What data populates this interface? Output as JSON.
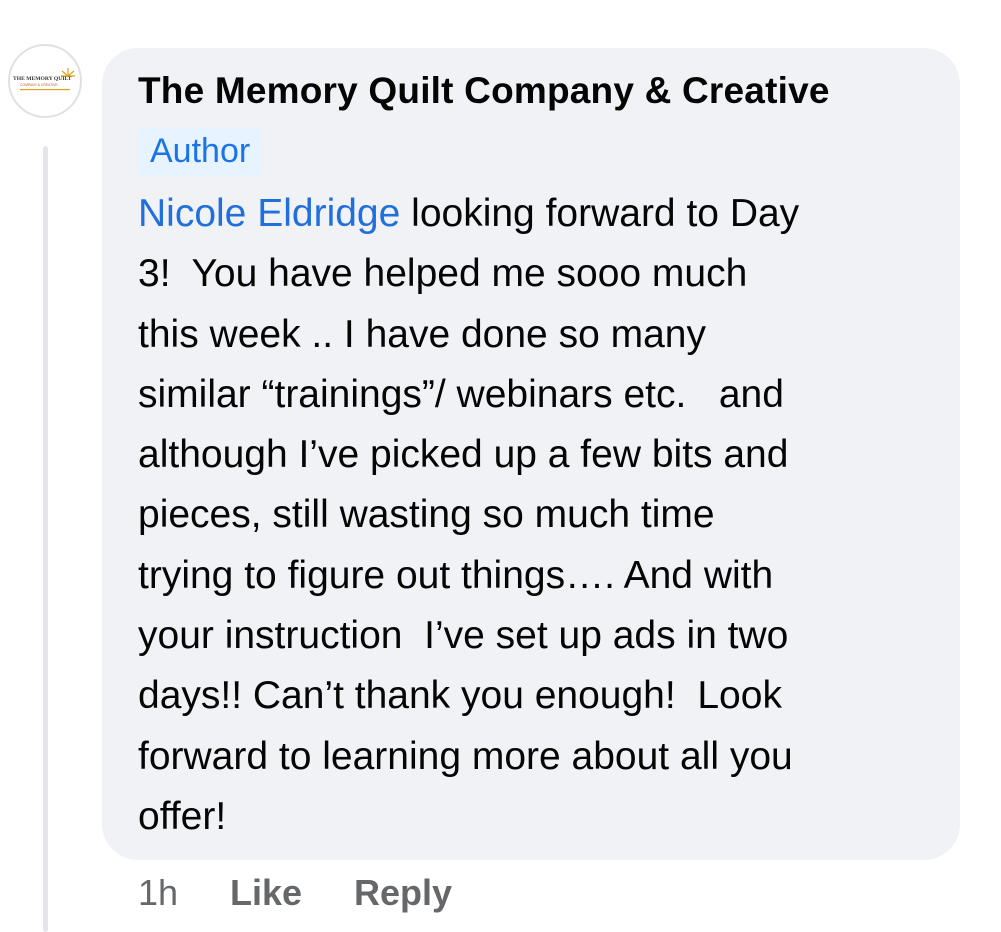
{
  "comment": {
    "author_name": "The Memory Quilt Company & Creative",
    "author_badge": "Author",
    "avatar": {
      "logo_text": "THE MEMORY QUILT",
      "logo_subtext": "COMPANY & CREATIVE",
      "icon": "sun-logo-icon"
    },
    "mention": "Nicole Eldridge",
    "text_lines": [
      " looking forward to Day",
      "3!  You have helped me sooo much",
      "this week .. I have done so many",
      "similar “trainings”/ webinars etc.   and",
      "although I’ve picked up a few bits and",
      "pieces, still wasting so much time",
      "trying to figure out things…. And with",
      "your instruction  I’ve set up ads in two",
      "days!! Can’t thank you enough!  Look",
      "forward to learning more about all you",
      "offer!"
    ],
    "time": "1h",
    "like_label": "Like",
    "reply_label": "Reply"
  },
  "colors": {
    "bubble": "#f0f2f5",
    "mention": "#216fdb",
    "badge_bg": "#e7f3ff",
    "badge_text": "#1b74e4",
    "meta_text": "#65676b"
  }
}
